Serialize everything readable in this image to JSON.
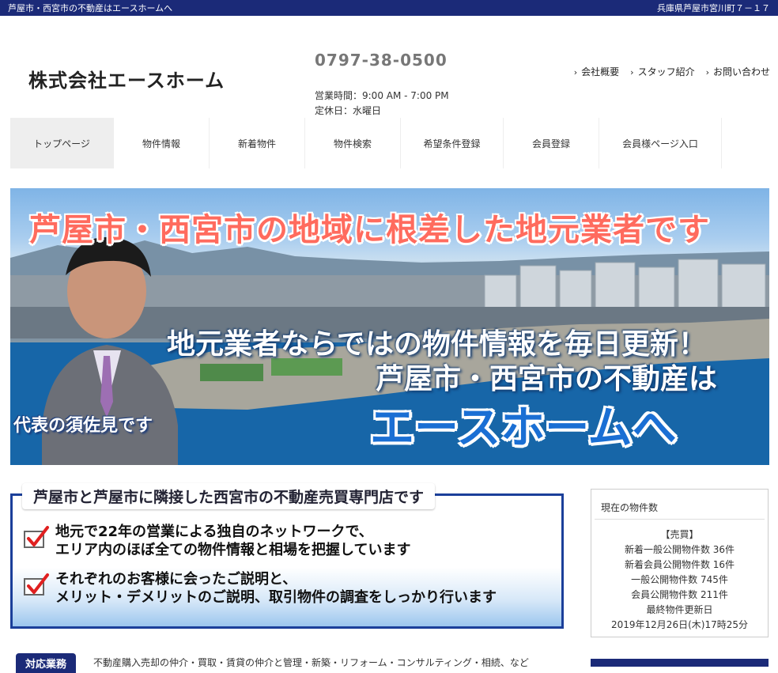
{
  "topbar": {
    "left": "芦屋市・西宮市の不動産はエースホームへ",
    "right": "兵庫県芦屋市宮川町７－１７"
  },
  "header": {
    "logo": "株式会社エースホーム",
    "phone": "0797-38-0500",
    "hours": "営業時間：9:00 AM - 7:00 PM",
    "holiday": "定休日：水曜日",
    "links": [
      "会社概要",
      "スタッフ紹介",
      "お問い合わせ"
    ]
  },
  "nav": {
    "items": [
      "トップページ",
      "物件情報",
      "新着物件",
      "物件検索",
      "希望条件登録",
      "会員登録",
      "会員様ページ入口"
    ],
    "active_index": 0
  },
  "hero": {
    "headline": "芦屋市・西宮市の地域に根差した地元業者です",
    "line2": "地元業者ならではの物件情報を毎日更新！",
    "line3": "芦屋市・西宮市の不動産は",
    "line4": "エースホームへ",
    "caption": "代表の須佐見です"
  },
  "feature": {
    "title": "芦屋市と芦屋市に隣接した西宮市の不動産売買専門店です",
    "points": [
      {
        "line1": "地元で22年の営業による独自のネットワークで、",
        "line2": "エリア内のほぼ全ての物件情報と相場を把握しています"
      },
      {
        "line1": "それぞれのお客様に会ったご説明と、",
        "line2": "メリット・デメリットのご説明、取引物件の調査をしっかり行います"
      }
    ]
  },
  "sidebar": {
    "title": "現在の物件数",
    "lines": [
      "【売買】",
      "新着一般公開物件数 36件",
      "新着会員公開物件数 16件",
      "一般公開物件数 745件",
      "会員公開物件数 211件",
      "最終物件更新日",
      "2019年12月26日(木)17時25分"
    ]
  },
  "services": {
    "badge": "対応業務",
    "text": "不動産購入売却の仲介・買取・賃貸の仲介と管理・新築・リフォーム・コンサルティング・相続、など"
  },
  "colors": {
    "brand_navy": "#1b2a78",
    "headline_red": "#ff6b5e",
    "accent_blue": "#1a6fd4"
  }
}
